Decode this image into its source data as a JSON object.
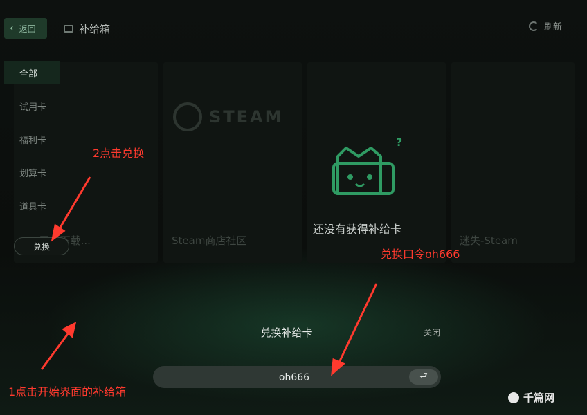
{
  "header": {
    "back_label": "返回",
    "title": "补给箱",
    "refresh_label": "刷新"
  },
  "sidebar": {
    "items": [
      {
        "label": "全部",
        "active": true
      },
      {
        "label": "试用卡",
        "active": false
      },
      {
        "label": "福利卡",
        "active": false
      },
      {
        "label": "划算卡",
        "active": false
      },
      {
        "label": "道具卡",
        "active": false
      }
    ],
    "redeem_label": "兑换"
  },
  "cards": {
    "card1_title": "...A平台下载...",
    "card2_title": "Steam商店社区",
    "steam_word": "STEAM",
    "card4_title": "迷失-Steam"
  },
  "empty_state": {
    "title": "还没有获得补给卡",
    "question_mark": "?"
  },
  "redeem_panel": {
    "title": "兑换补给卡",
    "close_label": "关闭",
    "code_value": "oh666",
    "enter_symbol": "⮐"
  },
  "annotations": {
    "step1": "1点击开始界面的补给箱",
    "step2": "2点击兑换",
    "code_hint": "兑换口令oh666"
  },
  "watermark": {
    "text": "千篇网"
  },
  "colors": {
    "annotation": "#ff3a2e",
    "accent_green": "#2f9b63",
    "background": "#0c0f0d"
  }
}
